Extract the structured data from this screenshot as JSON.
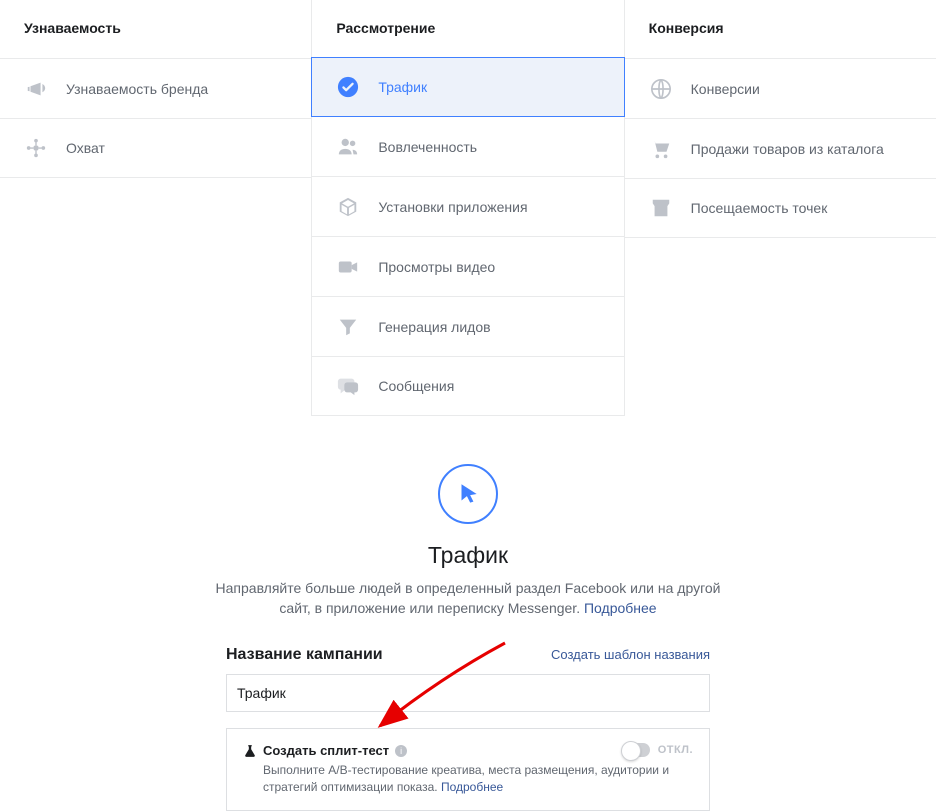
{
  "columns": {
    "awareness": {
      "header": "Узнаваемость",
      "items": [
        {
          "label": "Узнаваемость бренда",
          "icon": "megaphone"
        },
        {
          "label": "Охват",
          "icon": "reach"
        }
      ]
    },
    "consideration": {
      "header": "Рассмотрение",
      "items": [
        {
          "label": "Трафик",
          "icon": "check",
          "selected": true
        },
        {
          "label": "Вовлеченность",
          "icon": "people"
        },
        {
          "label": "Установки приложения",
          "icon": "box"
        },
        {
          "label": "Просмотры видео",
          "icon": "video"
        },
        {
          "label": "Генерация лидов",
          "icon": "funnel"
        },
        {
          "label": "Сообщения",
          "icon": "chat"
        }
      ]
    },
    "conversion": {
      "header": "Конверсия",
      "items": [
        {
          "label": "Конверсии",
          "icon": "globe"
        },
        {
          "label": "Продажи товаров из каталога",
          "icon": "cart"
        },
        {
          "label": "Посещаемость точек",
          "icon": "store"
        }
      ]
    }
  },
  "details": {
    "title": "Трафик",
    "description": "Направляйте больше людей в определенный раздел Facebook или на другой сайт, в приложение или переписку Messenger.",
    "learn_more": "Подробнее"
  },
  "form": {
    "campaign_name_label": "Название кампании",
    "template_link": "Создать шаблон названия",
    "campaign_name_value": "Трафик"
  },
  "split_test": {
    "title": "Создать сплит-тест",
    "description": "Выполните А/В-тестирование креатива, места размещения, аудитории и стратегий оптимизации показа.",
    "learn_more": "Подробнее",
    "toggle_label": "ОТКЛ."
  }
}
